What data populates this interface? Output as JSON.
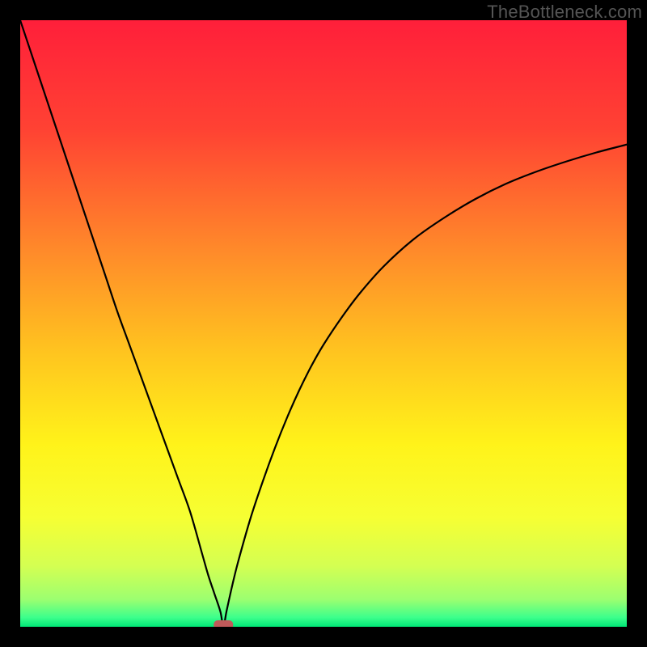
{
  "watermark": "TheBottleneck.com",
  "chart_data": {
    "type": "line",
    "title": "",
    "xlabel": "",
    "ylabel": "",
    "xlim": [
      0,
      100
    ],
    "ylim": [
      0,
      100
    ],
    "grid": false,
    "legend": false,
    "background_gradient": {
      "direction": "vertical",
      "stops": [
        {
          "pos": 0.0,
          "color": "#ff1f3a"
        },
        {
          "pos": 0.18,
          "color": "#ff4233"
        },
        {
          "pos": 0.38,
          "color": "#ff8a2a"
        },
        {
          "pos": 0.55,
          "color": "#ffc51f"
        },
        {
          "pos": 0.7,
          "color": "#fff31a"
        },
        {
          "pos": 0.82,
          "color": "#f6ff33"
        },
        {
          "pos": 0.9,
          "color": "#d4ff52"
        },
        {
          "pos": 0.955,
          "color": "#9cff70"
        },
        {
          "pos": 0.985,
          "color": "#3bff8c"
        },
        {
          "pos": 1.0,
          "color": "#00e676"
        }
      ]
    },
    "minimum_marker": {
      "x": 33.5,
      "y": 0,
      "color": "#c05a5a",
      "shape": "rounded-rect"
    },
    "series": [
      {
        "name": "curve",
        "color": "#000000",
        "x": [
          0,
          2,
          4,
          6,
          8,
          10,
          12,
          14,
          16,
          18,
          20,
          22,
          24,
          26,
          28,
          30,
          31,
          32,
          33,
          33.5,
          34,
          35,
          36,
          38,
          40,
          42,
          44,
          46,
          48,
          50,
          53,
          56,
          60,
          65,
          70,
          75,
          80,
          85,
          90,
          95,
          100
        ],
        "y": [
          100,
          94,
          88,
          82,
          76,
          70,
          64,
          58,
          52,
          46.5,
          41,
          35.5,
          30,
          24.5,
          19,
          12,
          8.5,
          5.5,
          2.5,
          0,
          2.5,
          7,
          11,
          18,
          24,
          29.5,
          34.5,
          39,
          43,
          46.5,
          51,
          55,
          59.5,
          64,
          67.5,
          70.5,
          73,
          75,
          76.7,
          78.2,
          79.5
        ]
      }
    ]
  }
}
